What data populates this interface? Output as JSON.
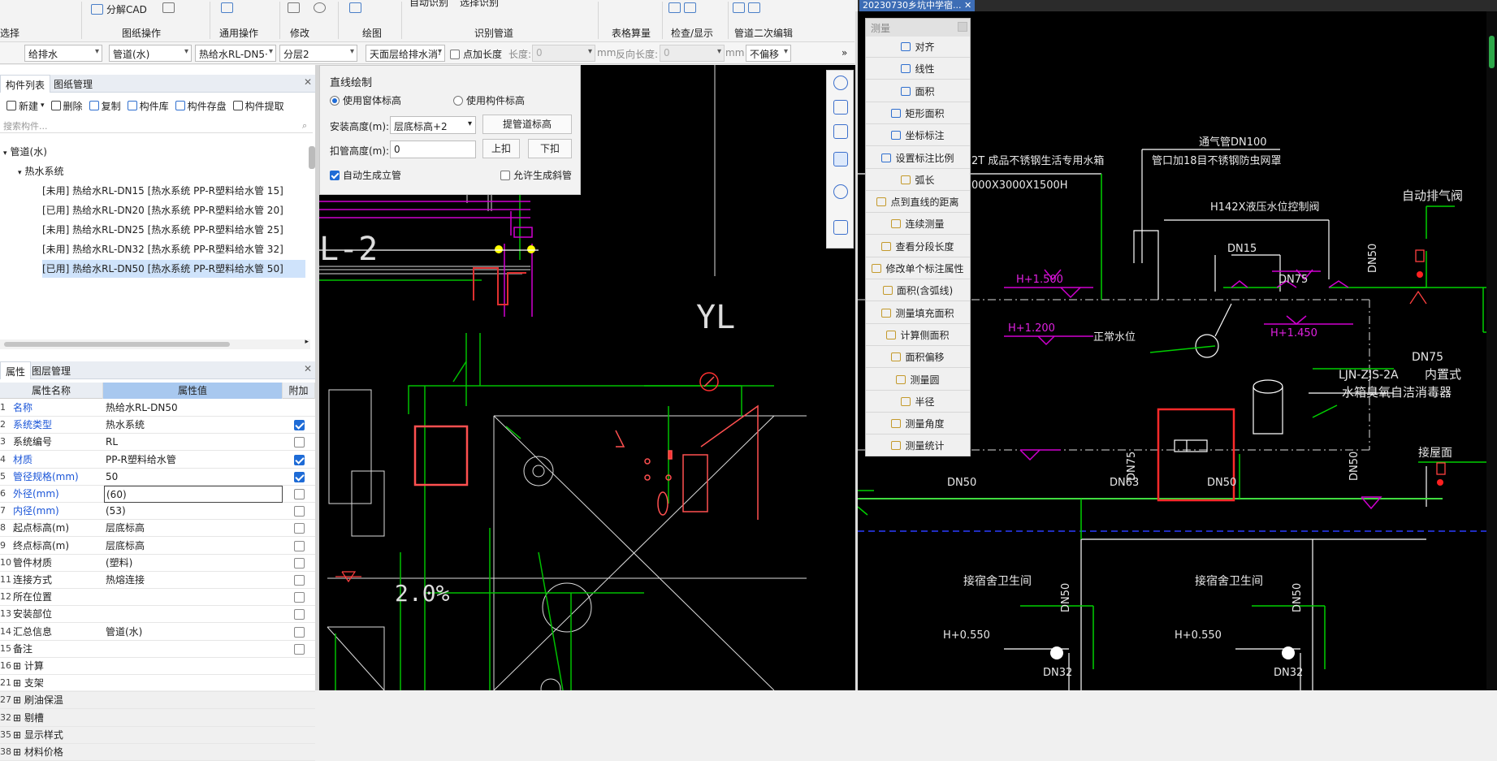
{
  "ribbon": {
    "group_labels": [
      "选择",
      "图纸操作",
      "通用操作",
      "修改",
      "绘图",
      "识别管道",
      "表格算量",
      "检查/显示",
      "管道二次编辑"
    ],
    "items": [
      "分解CAD",
      "自动识别",
      "选择识别"
    ]
  },
  "toolbar2": {
    "system": "给排水",
    "type": "管道(水)",
    "component": "热给水RL-DN5·",
    "floor": "分层2",
    "elevation": "天面层给排水消·",
    "point_length_label": "点加长度",
    "length_label": "长度:",
    "length_value": "0",
    "unit1": "mm",
    "reverse_label": "反向长度:",
    "reverse_value": "0",
    "unit2": "mm",
    "offset": "不偏移"
  },
  "left": {
    "tabs": [
      "构件列表",
      "图纸管理"
    ],
    "actions": [
      "新建",
      "删除",
      "复制",
      "构件库",
      "构件存盘",
      "构件提取"
    ],
    "search_placeholder": "搜索构件...",
    "tree": [
      {
        "label": "管道(水)",
        "level": 0
      },
      {
        "label": "热水系统",
        "level": 1
      },
      {
        "label": "[未用] 热给水RL-DN15 [热水系统 PP-R塑料给水管 15]",
        "level": 2
      },
      {
        "label": "[已用] 热给水RL-DN20 [热水系统 PP-R塑料给水管 20]",
        "level": 2
      },
      {
        "label": "[未用] 热给水RL-DN25 [热水系统 PP-R塑料给水管 25]",
        "level": 2
      },
      {
        "label": "[未用] 热给水RL-DN32 [热水系统 PP-R塑料给水管 32]",
        "level": 2
      },
      {
        "label": "[已用] 热给水RL-DN50 [热水系统 PP-R塑料给水管 50]",
        "level": 2,
        "selected": true
      }
    ],
    "prop_tabs": [
      "属性",
      "图层管理"
    ],
    "prop_headers": [
      "属性名称",
      "属性值",
      "附加"
    ],
    "properties": [
      {
        "no": "1",
        "name": "名称",
        "value": "热给水RL-DN50",
        "blue": true,
        "cb": null
      },
      {
        "no": "2",
        "name": "系统类型",
        "value": "热水系统",
        "blue": true,
        "cb": true
      },
      {
        "no": "3",
        "name": "系统编号",
        "value": "RL",
        "blue": false,
        "cb": false
      },
      {
        "no": "4",
        "name": "材质",
        "value": "PP-R塑料给水管",
        "blue": true,
        "cb": true
      },
      {
        "no": "5",
        "name": "管径规格(mm)",
        "value": "50",
        "blue": true,
        "cb": true
      },
      {
        "no": "6",
        "name": "外径(mm)",
        "value": "(60)",
        "blue": true,
        "cb": false
      },
      {
        "no": "7",
        "name": "内径(mm)",
        "value": "(53)",
        "blue": true,
        "cb": false
      },
      {
        "no": "8",
        "name": "起点标高(m)",
        "value": "层底标高",
        "blue": false,
        "cb": false
      },
      {
        "no": "9",
        "name": "终点标高(m)",
        "value": "层底标高",
        "blue": false,
        "cb": false
      },
      {
        "no": "10",
        "name": "管件材质",
        "value": "(塑料)",
        "blue": false,
        "cb": false
      },
      {
        "no": "11",
        "name": "连接方式",
        "value": "热熔连接",
        "blue": false,
        "cb": false
      },
      {
        "no": "12",
        "name": "所在位置",
        "value": "",
        "blue": false,
        "cb": false
      },
      {
        "no": "13",
        "name": "安装部位",
        "value": "",
        "blue": false,
        "cb": false
      },
      {
        "no": "14",
        "name": "汇总信息",
        "value": "管道(水)",
        "blue": false,
        "cb": false
      },
      {
        "no": "15",
        "name": "备注",
        "value": "",
        "blue": false,
        "cb": false
      },
      {
        "no": "16",
        "name": "⊞ 计算",
        "value": "",
        "blue": false,
        "cb": null
      },
      {
        "no": "21",
        "name": "⊞ 支架",
        "value": "",
        "blue": false,
        "cb": null
      },
      {
        "no": "27",
        "name": "⊞ 刷油保温",
        "value": "",
        "blue": false,
        "cb": null
      },
      {
        "no": "32",
        "name": "⊞ 剔槽",
        "value": "",
        "blue": false,
        "cb": null
      },
      {
        "no": "35",
        "name": "⊞ 显示样式",
        "value": "",
        "blue": false,
        "cb": null
      },
      {
        "no": "38",
        "name": "⊞ 材料价格",
        "value": "",
        "blue": false,
        "cb": null
      }
    ]
  },
  "dialog": {
    "title": "直线绘制",
    "radio1": "使用窗体标高",
    "radio2": "使用构件标高",
    "install_label": "安装高度(m):",
    "install_value": "层底标高+2",
    "pick_button": "提管道标高",
    "buckle_label": "扣管高度(m):",
    "buckle_value": "0",
    "up_button": "上扣",
    "down_button": "下扣",
    "auto_riser": "自动生成立管",
    "allow_slope": "允许生成斜管"
  },
  "right_tab": "20230730乡坑中学宿...",
  "measure_menu": {
    "title": "测量",
    "items": [
      "对齐",
      "线性",
      "面积",
      "矩形面积",
      "坐标标注",
      "设置标注比例",
      "弧长",
      "点到直线的距离",
      "连续测量",
      "查看分段长度",
      "修改单个标注属性",
      "面积(含弧线)",
      "测量填充面积",
      "计算侧面积",
      "面积偏移",
      "测量圆",
      "半径",
      "测量角度",
      "测量统计"
    ]
  },
  "cad_left": {
    "texts": [
      "L-2",
      "YL",
      "2.0%"
    ]
  },
  "cad_right": {
    "texts": {
      "vent": "通气管DN100",
      "pipe_note": "管口加18目不锈钢防虫网罩",
      "tank": "2T 成品不锈钢生活专用水箱",
      "tank_size": "000X3000X1500H",
      "valve": "H142X液压水位控制阀",
      "auto_vent": "自动排气阀",
      "dn15": "DN15",
      "dn75a": "DN75",
      "dn75b": "DN75",
      "h1500": "H+1.500",
      "h1200": "H+1.200",
      "normal_level": "正常水位",
      "h1450": "H+1.450",
      "builtin": "内置式",
      "ljn": "LJN-ZJS-2A",
      "disinfect": "水箱臭氧自洁消毒器",
      "dn50a": "DN50",
      "dn63": "DN63",
      "dn50b": "DN50",
      "dn75c": "DN75",
      "dn50c": "DN50",
      "dn50d": "DN50",
      "roof": "接屋面",
      "toilet1": "接宿舍卫生间",
      "toilet2": "接宿舍卫生间",
      "h550a": "H+0.550",
      "h550b": "H+0.550",
      "dn32a": "DN32",
      "dn32b": "DN32",
      "dn50e": "DN50",
      "dn50f": "DN50"
    }
  }
}
